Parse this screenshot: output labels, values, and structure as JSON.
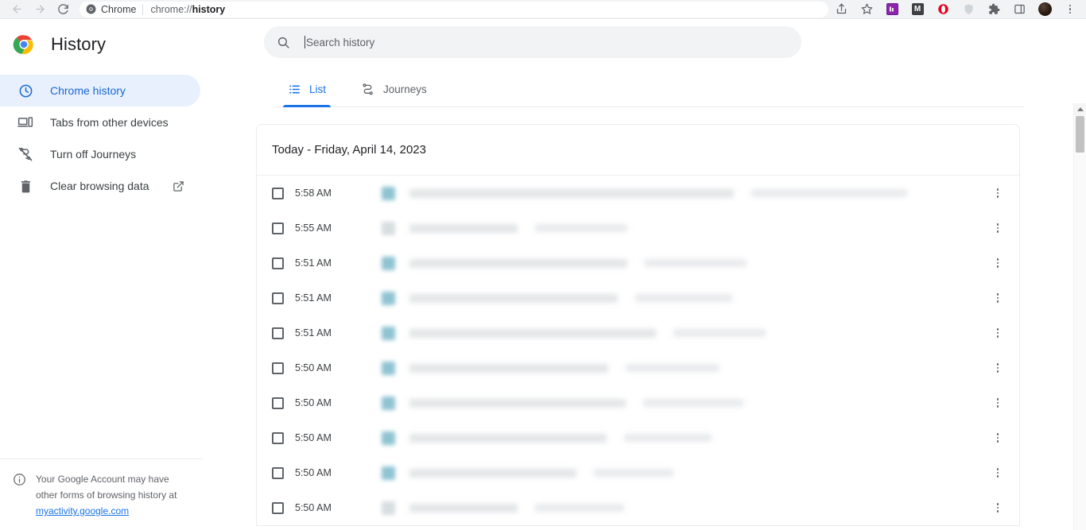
{
  "browser": {
    "nav": {
      "back": "back-arrow",
      "forward": "forward-arrow",
      "reload": "reload"
    },
    "omnibox": {
      "chip_label": "Chrome",
      "url_prefix": "chrome://",
      "url_bold": "history",
      "full_url": "chrome://history"
    },
    "toolbar_icons": [
      {
        "name": "share-icon",
        "label": "Share"
      },
      {
        "name": "bookmark-star-icon",
        "label": "Bookmark"
      },
      {
        "name": "extension-purple-icon",
        "label": "",
        "color": "#7b1fa2"
      },
      {
        "name": "gmail-extension-icon",
        "label": "M",
        "color": "#3c4043"
      },
      {
        "name": "opera-extension-icon",
        "label": "",
        "color": "#e8001f"
      },
      {
        "name": "shield-extension-icon",
        "label": "",
        "color": "#c8ccd0"
      },
      {
        "name": "extensions-puzzle-icon",
        "label": ""
      },
      {
        "name": "side-panel-icon",
        "label": ""
      },
      {
        "name": "profile-avatar",
        "label": ""
      },
      {
        "name": "chrome-menu-icon",
        "label": ""
      }
    ]
  },
  "sidebar": {
    "title": "History",
    "items": [
      {
        "label": "Chrome history",
        "icon": "clock-icon",
        "active": true
      },
      {
        "label": "Tabs from other devices",
        "icon": "devices-icon",
        "active": false
      },
      {
        "label": "Turn off Journeys",
        "icon": "journeys-off-icon",
        "active": false
      },
      {
        "label": "Clear browsing data",
        "icon": "trash-icon",
        "active": false,
        "external": true
      }
    ],
    "footer": {
      "icon": "info-icon",
      "text_before": "Your Google Account may have other forms of browsing history at ",
      "link": "myactivity.google.com"
    }
  },
  "search": {
    "placeholder": "Search history",
    "value": "",
    "icon": "search-icon"
  },
  "tabs": [
    {
      "label": "List",
      "icon": "list-icon",
      "active": true
    },
    {
      "label": "Journeys",
      "icon": "journeys-icon",
      "active": false
    }
  ],
  "history": {
    "group_title": "Today - Friday, April 14, 2023",
    "accent_color": "#1a73e8",
    "rows": [
      {
        "time": "5:58 AM",
        "title_redacted": true,
        "title_width": 408,
        "url_width": 196,
        "favicon": "teal"
      },
      {
        "time": "5:55 AM",
        "title_redacted": true,
        "title_width": 136,
        "url_width": 116,
        "favicon": "pale"
      },
      {
        "time": "5:51 AM",
        "title_redacted": true,
        "title_width": 274,
        "url_width": 128,
        "favicon": "teal"
      },
      {
        "time": "5:51 AM",
        "title_redacted": true,
        "title_width": 262,
        "url_width": 122,
        "favicon": "teal"
      },
      {
        "time": "5:51 AM",
        "title_redacted": true,
        "title_width": 310,
        "url_width": 116,
        "favicon": "teal"
      },
      {
        "time": "5:50 AM",
        "title_redacted": true,
        "title_width": 250,
        "url_width": 118,
        "favicon": "teal"
      },
      {
        "time": "5:50 AM",
        "title_redacted": true,
        "title_width": 272,
        "url_width": 126,
        "favicon": "teal"
      },
      {
        "time": "5:50 AM",
        "title_redacted": true,
        "title_width": 248,
        "url_width": 110,
        "favicon": "teal"
      },
      {
        "time": "5:50 AM",
        "title_redacted": true,
        "title_width": 210,
        "url_width": 100,
        "favicon": "teal"
      },
      {
        "time": "5:50 AM",
        "title_redacted": true,
        "title_width": 136,
        "url_width": 112,
        "favicon": "pale"
      }
    ],
    "row_menu_icon": "more-vertical-icon"
  },
  "scrollbar": {
    "up_arrow": "scroll-up-arrow",
    "thumb_position": "top"
  }
}
